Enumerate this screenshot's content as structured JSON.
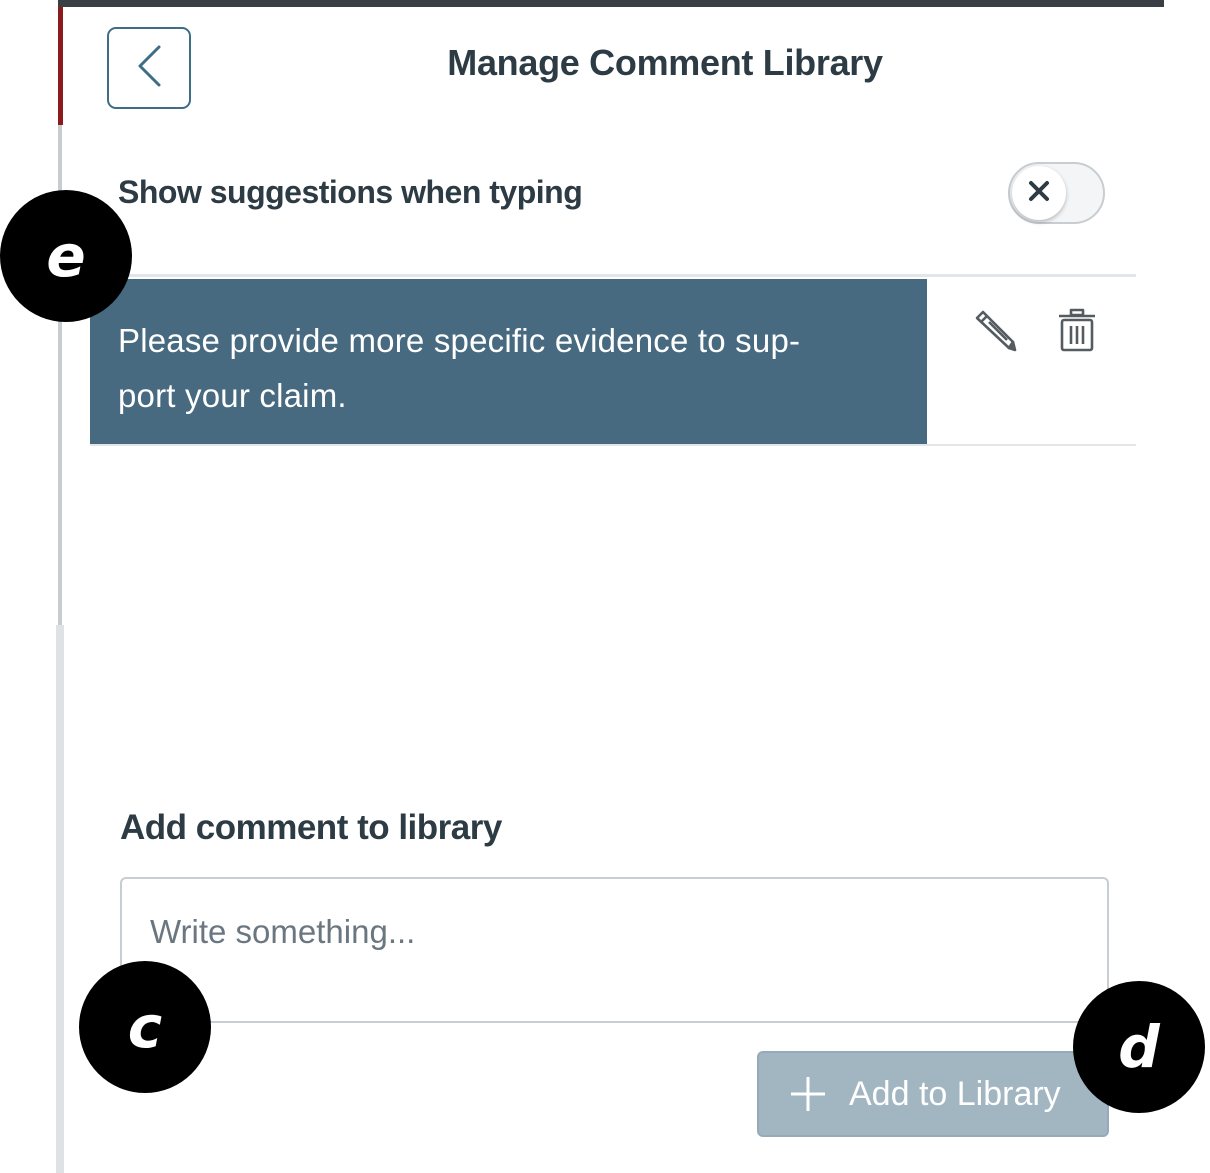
{
  "header": {
    "title": "Manage Comment Library",
    "back_icon": "chevron-left-icon"
  },
  "settings": {
    "suggestions_label": "Show suggestions when typing",
    "suggestions_enabled": false,
    "toggle_icon": "close-icon"
  },
  "comments": [
    {
      "text_line_1": "Please provide more specific evidence to sup-",
      "text_line_2": "port your claim.",
      "edit_icon": "pencil-icon",
      "delete_icon": "trash-icon"
    }
  ],
  "add_section": {
    "heading": "Add comment to library",
    "input_placeholder": "Write something...",
    "input_value": "",
    "button_label": "Add to Library",
    "button_icon": "plus-icon"
  },
  "annotations": {
    "e": "e",
    "c": "c",
    "d": "d"
  },
  "colors": {
    "selected_comment_bg": "#476a80",
    "accent_border": "#3e6e86",
    "disabled_button_bg": "#a2b6c1",
    "text_primary": "#2d3b45"
  }
}
